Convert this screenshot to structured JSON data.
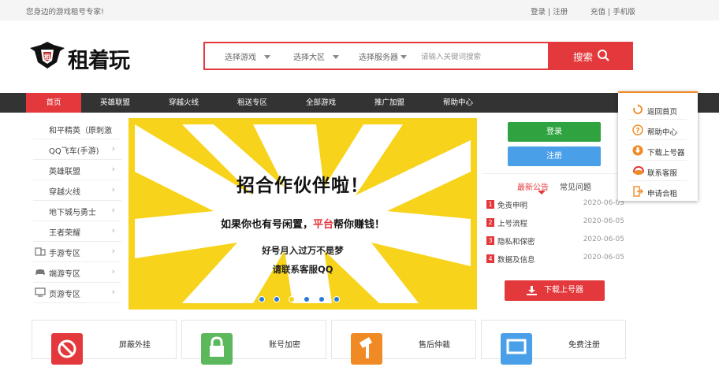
{
  "topbar": {
    "welcome": "您身边的游戏租号专家!",
    "login_register": "登录 | 注册",
    "recharge_mobile": "充值 | 手机版"
  },
  "logo": {
    "text": "租着玩"
  },
  "search": {
    "select_game": "选择游戏",
    "select_region": "选择大区",
    "select_server": "选择服务器",
    "placeholder": "请输入关键词搜索",
    "button": "搜索"
  },
  "nav": {
    "items": [
      "首页",
      "英雄联盟",
      "穿越火线",
      "租送专区",
      "全部游戏",
      "推广加盟",
      "帮助中心"
    ],
    "active": "首页",
    "bg_color": "#333333",
    "active_color": "#e4393c"
  },
  "leftmenu": {
    "items": [
      {
        "label": "和平精英（原刺激",
        "icon": ""
      },
      {
        "label": "QQ飞车(手游)",
        "icon": ""
      },
      {
        "label": "英雄联盟",
        "icon": ""
      },
      {
        "label": "穿越火线",
        "icon": ""
      },
      {
        "label": "地下城与勇士",
        "icon": ""
      },
      {
        "label": "王者荣耀",
        "icon": ""
      },
      {
        "label": "手游专区",
        "icon": "mobile-icon"
      },
      {
        "label": "端游专区",
        "icon": "gamepad-icon"
      },
      {
        "label": "页游专区",
        "icon": "monitor-icon"
      }
    ]
  },
  "banner": {
    "title": "招合作伙伴啦！",
    "line2_before": "如果你也有号闲置，",
    "line2_highlight": "平台",
    "line2_after": "帮你赚钱！",
    "line3": "好号月入过万不是梦",
    "line4": "请联系客服QQ",
    "slide_count": 6,
    "current_slide": 3,
    "bg_color": "#f7d31c"
  },
  "account": {
    "login": "登录",
    "register": "注册"
  },
  "notice_tabs": {
    "latest": "最新公告",
    "faq": "常见问题"
  },
  "news": [
    {
      "num": "1",
      "title": "免责申明",
      "date": "2020-06-05"
    },
    {
      "num": "2",
      "title": "上号流程",
      "date": "2020-06-05"
    },
    {
      "num": "3",
      "title": "隐私和保密",
      "date": "2020-06-05"
    },
    {
      "num": "4",
      "title": "数据及信息",
      "date": "2020-06-05"
    }
  ],
  "download_button": "下载上号器",
  "float_menu": {
    "items": [
      {
        "label": "返回首页",
        "icon": "refresh-icon"
      },
      {
        "label": "帮助中心",
        "icon": "question-icon"
      },
      {
        "label": "下载上号器",
        "icon": "download-icon"
      },
      {
        "label": "联系客服",
        "icon": "headset-icon"
      },
      {
        "label": "申请合租",
        "icon": "exit-icon"
      }
    ]
  },
  "features": [
    {
      "label": "屏蔽外挂",
      "icon": "no-cheat-icon",
      "color": "#e4393c"
    },
    {
      "label": "账号加密",
      "icon": "lock-icon",
      "color": "#5cb85c"
    },
    {
      "label": "售后仲裁",
      "icon": "hammer-icon",
      "color": "#f08a24"
    },
    {
      "label": "免费注册",
      "icon": "monitor-icon",
      "color": "#4aa0e8"
    }
  ]
}
